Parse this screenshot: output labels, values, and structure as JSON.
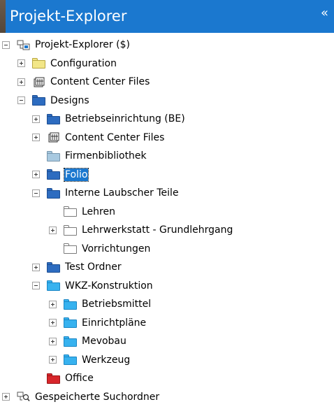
{
  "panel": {
    "title": "Projekt-Explorer",
    "collapse_glyph": "«"
  },
  "colors": {
    "title_bg": "#1b78cf",
    "folder_yellow": "#f2e687",
    "folder_blue": "#2d6cc0",
    "folder_cyan": "#37b2ef",
    "folder_lightblue": "#a8c9e0",
    "folder_red": "#d8262b",
    "folder_white": "#ffffff",
    "selection": "#1b78cf"
  },
  "tree": [
    {
      "label": "Projekt-Explorer ($)",
      "depth": 0,
      "expander": "minus",
      "icon": "project-explorer-icon"
    },
    {
      "label": "Configuration",
      "depth": 1,
      "expander": "plus",
      "icon": "folder-yellow"
    },
    {
      "label": "Content Center Files",
      "depth": 1,
      "expander": "plus",
      "icon": "content-center-icon"
    },
    {
      "label": "Designs",
      "depth": 1,
      "expander": "minus",
      "icon": "folder-blue"
    },
    {
      "label": "Betriebseinrichtung (BE)",
      "depth": 2,
      "expander": "plus",
      "icon": "folder-blue"
    },
    {
      "label": "Content Center Files",
      "depth": 2,
      "expander": "plus",
      "icon": "content-center-icon"
    },
    {
      "label": "Firmenbibliothek",
      "depth": 2,
      "expander": "none",
      "icon": "folder-lightblue"
    },
    {
      "label": "Folio",
      "depth": 2,
      "expander": "plus",
      "icon": "folder-blue",
      "selected": true
    },
    {
      "label": "Interne Laubscher Teile",
      "depth": 2,
      "expander": "minus",
      "icon": "folder-blue"
    },
    {
      "label": "Lehren",
      "depth": 3,
      "expander": "none",
      "icon": "folder-white"
    },
    {
      "label": "Lehrwerkstatt - Grundlehrgang",
      "depth": 3,
      "expander": "plus",
      "icon": "folder-white"
    },
    {
      "label": "Vorrichtungen",
      "depth": 3,
      "expander": "none",
      "icon": "folder-white"
    },
    {
      "label": "Test Ordner",
      "depth": 2,
      "expander": "plus",
      "icon": "folder-blue"
    },
    {
      "label": "WKZ-Konstruktion",
      "depth": 2,
      "expander": "minus",
      "icon": "folder-cyan"
    },
    {
      "label": "Betriebsmittel",
      "depth": 3,
      "expander": "plus",
      "icon": "folder-cyan"
    },
    {
      "label": "Einrichtpläne",
      "depth": 3,
      "expander": "plus",
      "icon": "folder-cyan"
    },
    {
      "label": "Mevobau",
      "depth": 3,
      "expander": "plus",
      "icon": "folder-cyan"
    },
    {
      "label": "Werkzeug",
      "depth": 3,
      "expander": "plus",
      "icon": "folder-cyan"
    },
    {
      "label": "Office",
      "depth": 2,
      "expander": "none",
      "icon": "folder-red"
    },
    {
      "label": "Gespeicherte Suchordner",
      "depth": 0,
      "expander": "plus",
      "icon": "saved-search-icon"
    }
  ]
}
